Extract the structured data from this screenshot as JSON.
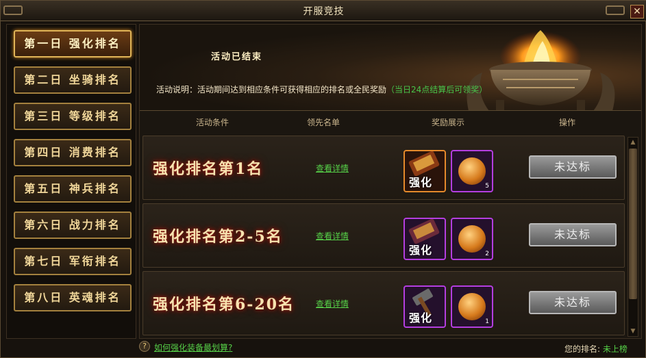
{
  "window": {
    "title": "开服竞技"
  },
  "sidebar": {
    "items": [
      {
        "label": "第一日 强化排名",
        "active": true
      },
      {
        "label": "第二日 坐骑排名",
        "active": false
      },
      {
        "label": "第三日 等级排名",
        "active": false
      },
      {
        "label": "第四日 消费排名",
        "active": false
      },
      {
        "label": "第五日 神兵排名",
        "active": false
      },
      {
        "label": "第六日 战力排名",
        "active": false
      },
      {
        "label": "第七日 军衔排名",
        "active": false
      },
      {
        "label": "第八日 英魂排名",
        "active": false
      }
    ]
  },
  "banner": {
    "status": "活动已结束",
    "description": "活动说明：活动期间达到相应条件可获得相应的排名或全民奖励",
    "note": "（当日24点结算后可领奖）"
  },
  "table": {
    "headers": [
      "活动条件",
      "领先名单",
      "奖励展示",
      "操作"
    ],
    "rows": [
      {
        "condition": "强化排名第1名",
        "detail": "查看详情",
        "rewards": [
          {
            "type": "scroll",
            "label": "强化",
            "rarity": "orange"
          },
          {
            "type": "orb",
            "count": "5",
            "rarity": "purple"
          }
        ],
        "action": "未达标"
      },
      {
        "condition": "强化排名第2-5名",
        "detail": "查看详情",
        "rewards": [
          {
            "type": "scroll",
            "label": "强化",
            "rarity": "purple"
          },
          {
            "type": "orb",
            "count": "2",
            "rarity": "purple"
          }
        ],
        "action": "未达标"
      },
      {
        "condition": "强化排名第6-20名",
        "detail": "查看详情",
        "rewards": [
          {
            "type": "scroll",
            "label": "强化",
            "rarity": "purple"
          },
          {
            "type": "orb",
            "count": "1",
            "rarity": "purple"
          }
        ],
        "action": "未达标"
      }
    ]
  },
  "footer": {
    "help_link": "如何强化装备最划算?",
    "my_rank_label": "您的排名:",
    "my_rank_value": "未上榜"
  },
  "colors": {
    "accent_gold": "#e0b457",
    "link_green": "#56d048",
    "rank_glow": "#a3150b"
  }
}
